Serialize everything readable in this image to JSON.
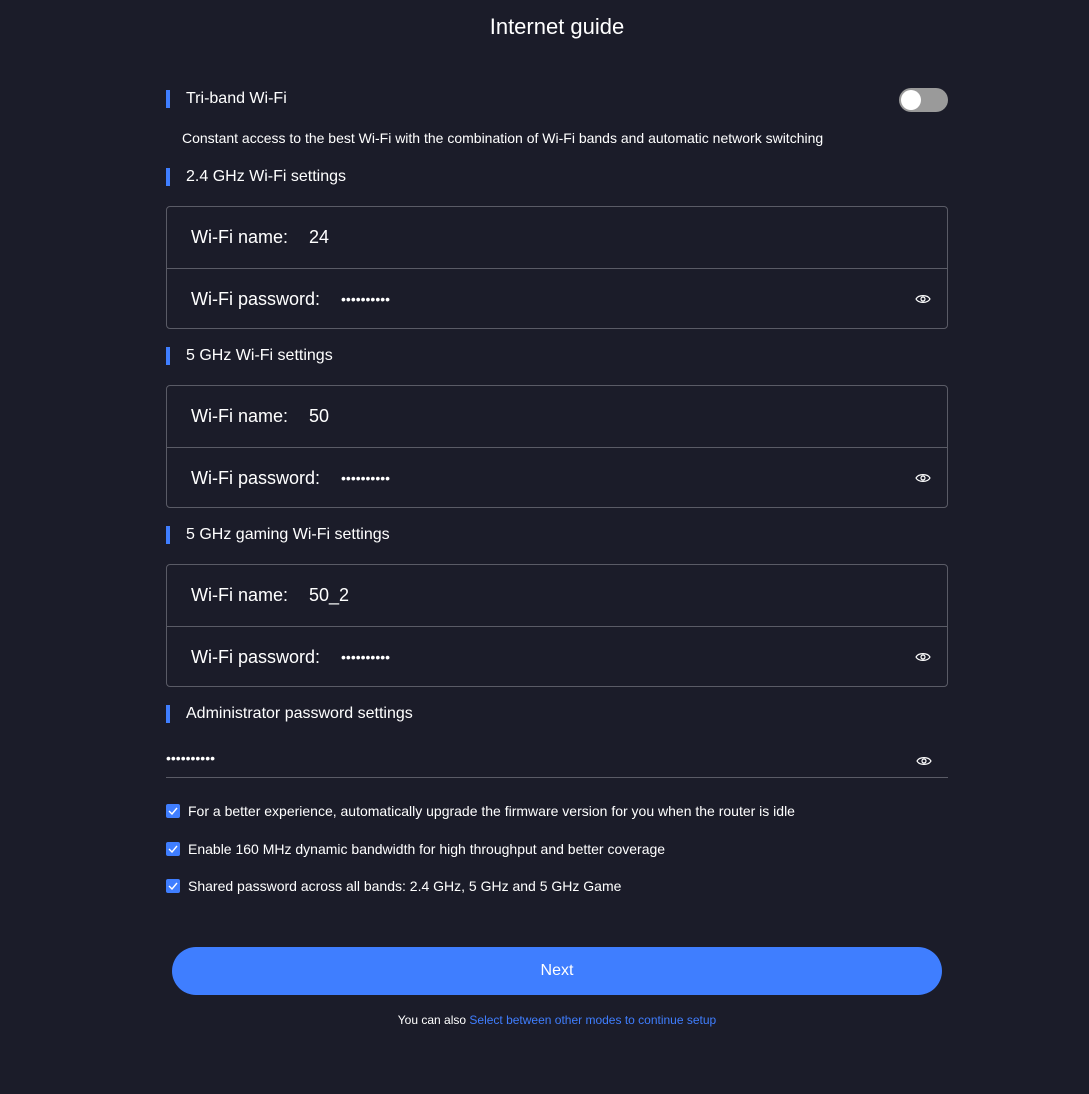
{
  "title": "Internet guide",
  "tri_band": {
    "label": "Tri-band Wi-Fi",
    "enabled": false,
    "description": "Constant access to the best Wi-Fi with the combination of Wi-Fi bands and automatic network switching"
  },
  "bands": [
    {
      "label": "2.4 GHz Wi-Fi settings",
      "name_label": "Wi-Fi name:",
      "name_value": "24",
      "password_label": "Wi-Fi password:",
      "password_mask": "••••••••••"
    },
    {
      "label": "5 GHz Wi-Fi settings",
      "name_label": "Wi-Fi name:",
      "name_value": "50",
      "password_label": "Wi-Fi password:",
      "password_mask": "••••••••••"
    },
    {
      "label": "5 GHz gaming Wi-Fi settings",
      "name_label": "Wi-Fi name:",
      "name_value": "50_2",
      "password_label": "Wi-Fi password:",
      "password_mask": "••••••••••"
    }
  ],
  "admin": {
    "label": "Administrator password settings",
    "password_mask": "••••••••••"
  },
  "options": [
    {
      "label": "For a better experience, automatically upgrade the firmware version for you when the router is idle",
      "checked": true
    },
    {
      "label": "Enable 160 MHz dynamic bandwidth for high throughput and better coverage",
      "checked": true
    },
    {
      "label": "Shared password across all bands: 2.4 GHz, 5 GHz and 5 GHz Game",
      "checked": true
    }
  ],
  "next_label": "Next",
  "footer": {
    "prefix": "You can also",
    "link": "Select between other modes to continue setup"
  },
  "colors": {
    "background": "#1b1c29",
    "accent": "#3f7eff",
    "border": "#5a5b66",
    "toggle_off": "#9a9a9a"
  },
  "icons": {
    "password_visibility": "eye-icon",
    "checkbox": "check-icon"
  }
}
